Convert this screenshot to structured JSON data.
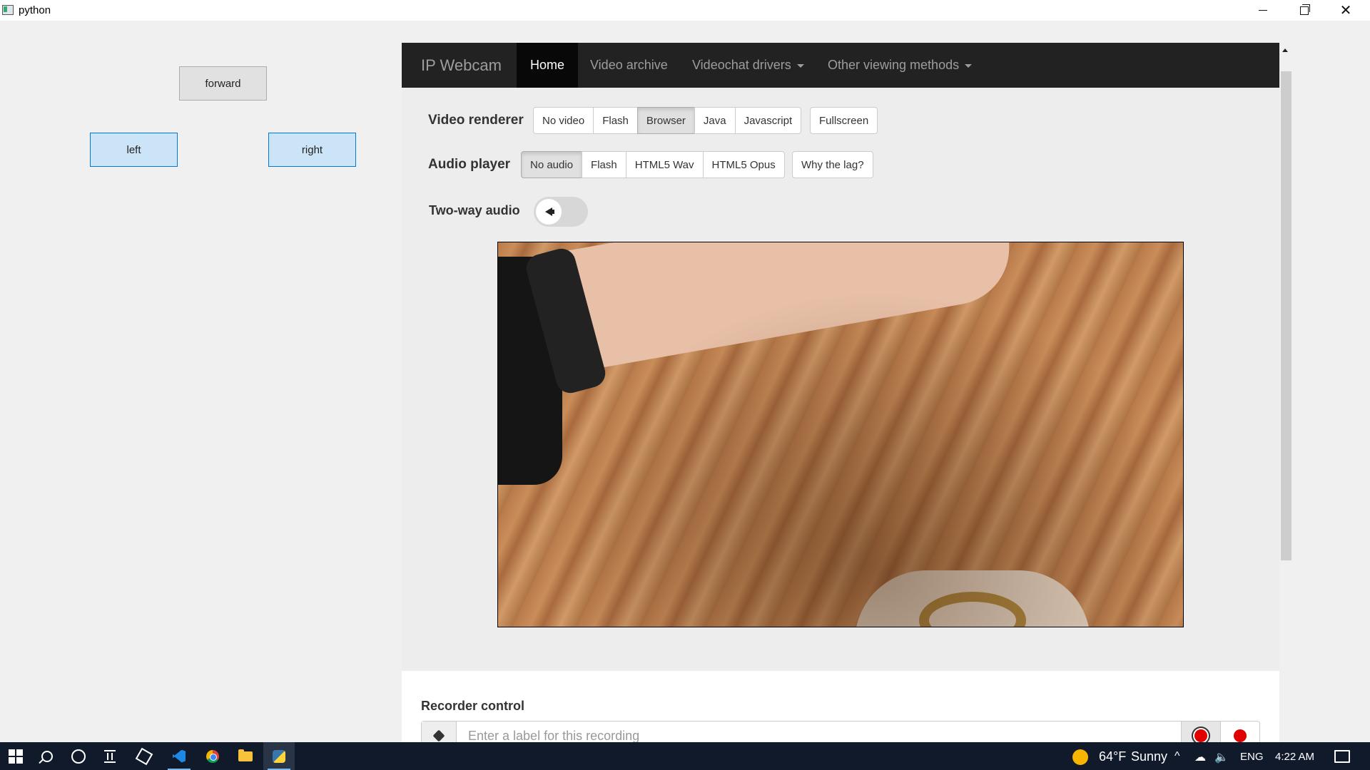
{
  "window": {
    "title": "python"
  },
  "controls": {
    "forward": "forward",
    "left": "left",
    "right": "right"
  },
  "navbar": {
    "brand": "IP Webcam",
    "items": [
      {
        "label": "Home",
        "active": true
      },
      {
        "label": "Video archive"
      },
      {
        "label": "Videochat drivers",
        "dropdown": true
      },
      {
        "label": "Other viewing methods",
        "dropdown": true
      }
    ]
  },
  "video_renderer": {
    "label": "Video renderer",
    "options": [
      "No video",
      "Flash",
      "Browser",
      "Java",
      "Javascript"
    ],
    "selected": "Browser",
    "fullscreen": "Fullscreen"
  },
  "audio_player": {
    "label": "Audio player",
    "options": [
      "No audio",
      "Flash",
      "HTML5 Wav",
      "HTML5 Opus"
    ],
    "selected": "No audio",
    "why_lag": "Why the lag?"
  },
  "two_way_audio": {
    "label": "Two-way audio",
    "icon": "megaphone-icon"
  },
  "recorder": {
    "title": "Recorder control",
    "placeholder": "Enter a label for this recording"
  },
  "taskbar": {
    "weather_temp": "64°F",
    "weather_desc": "Sunny",
    "language": "ENG",
    "time": "4:22 AM"
  }
}
